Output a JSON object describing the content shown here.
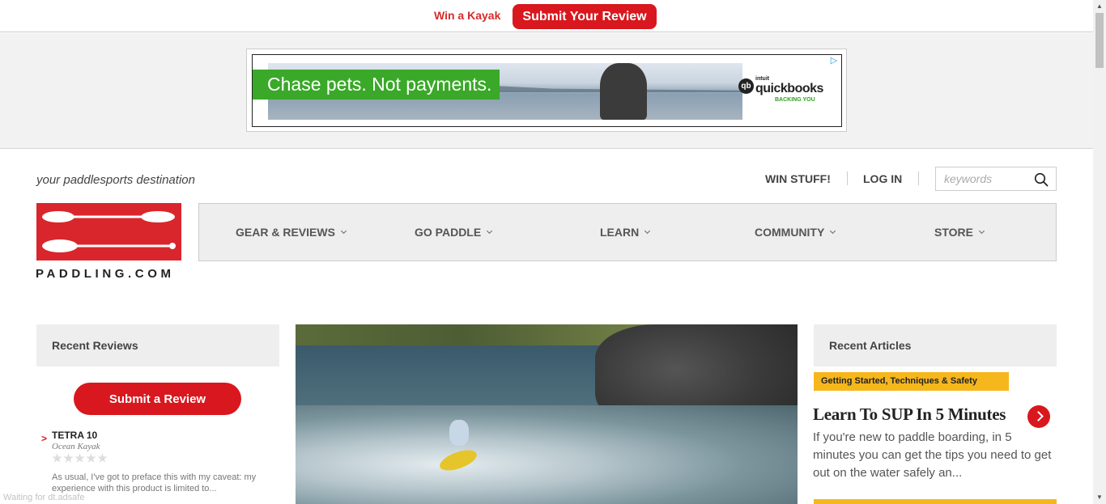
{
  "promo": {
    "text": "Win a Kayak",
    "button_label": "Submit Your Review"
  },
  "ad": {
    "headline": "Chase pets. Not payments.",
    "brand_prefix": "intuit",
    "brand_name": "quickbooks",
    "brand_tagline": "BACKING YOU",
    "brand_icon_text": "qb",
    "choices_icon": "ad-choices-icon"
  },
  "header": {
    "tagline": "your paddlesports destination",
    "win_stuff_label": "WIN STUFF!",
    "login_label": "LOG IN",
    "search_placeholder": "keywords",
    "search_icon": "search-icon"
  },
  "logo": {
    "wordmark": "PADDLING.COM",
    "color": "#d9262c"
  },
  "nav": {
    "items": [
      {
        "label": "GEAR & REVIEWS"
      },
      {
        "label": "GO PADDLE"
      },
      {
        "label": "LEARN"
      },
      {
        "label": "COMMUNITY"
      },
      {
        "label": "STORE"
      }
    ]
  },
  "recent_reviews": {
    "heading": "Recent Reviews",
    "submit_label": "Submit a Review",
    "items": [
      {
        "title": "TETRA 10",
        "brand": "Ocean Kayak",
        "rating": 0,
        "excerpt": "As usual, I've got to preface this with my caveat: my experience with this product is limited to..."
      }
    ]
  },
  "recent_articles": {
    "heading": "Recent Articles",
    "items": [
      {
        "category": "Getting Started, Techniques & Safety",
        "title": "Learn To SUP In 5 Minutes",
        "excerpt": "If you're new to paddle boarding, in 5 minutes you can get the tips you need to get out on the water safely an..."
      }
    ]
  },
  "status": {
    "text": "Waiting for dt.adsafe"
  },
  "colors": {
    "accent_red": "#d8181e",
    "tag_yellow": "#f6b71c",
    "ad_green": "#3aa828"
  }
}
